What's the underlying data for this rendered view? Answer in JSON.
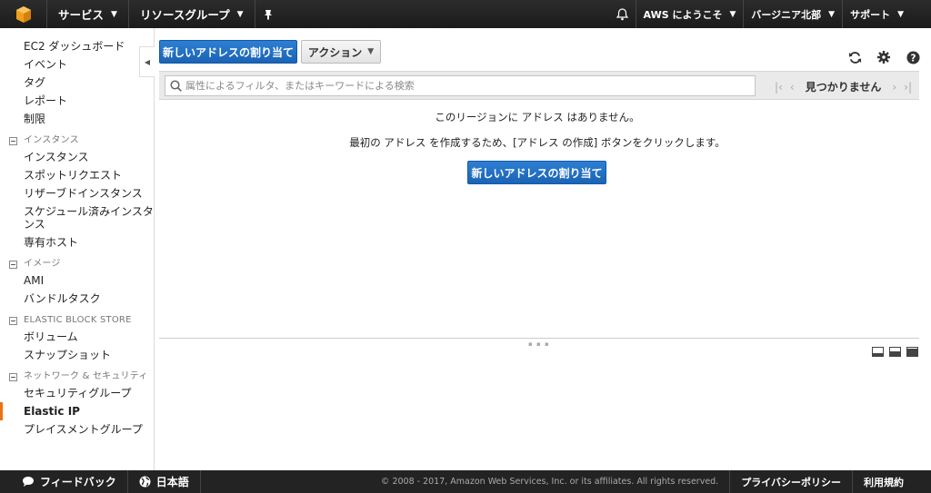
{
  "topnav": {
    "services": "サービス",
    "resource_groups": "リソースグループ",
    "account": "AWS にようこそ",
    "region": "バージニア北部",
    "support": "サポート"
  },
  "sidebar": {
    "top_items": [
      "EC2 ダッシュボード",
      "イベント",
      "タグ",
      "レポート",
      "制限"
    ],
    "sections": [
      {
        "heading": "インスタンス",
        "items": [
          "インスタンス",
          "スポットリクエスト",
          "リザーブドインスタンス",
          "スケジュール済みインスタンス",
          "専有ホスト"
        ]
      },
      {
        "heading": "イメージ",
        "items": [
          "AMI",
          "バンドルタスク"
        ]
      },
      {
        "heading": "ELASTIC BLOCK STORE",
        "items": [
          "ボリューム",
          "スナップショット"
        ]
      },
      {
        "heading": "ネットワーク & セキュリティ",
        "items": [
          "セキュリティグループ",
          "Elastic IP",
          "プレイスメントグループ"
        ]
      }
    ],
    "active_item": "Elastic IP"
  },
  "toolbar": {
    "allocate_label": "新しいアドレスの割り当て",
    "actions_label": "アクション"
  },
  "filter": {
    "placeholder": "属性によるフィルタ、またはキーワードによる検索",
    "pager_label": "見つかりません"
  },
  "empty_state": {
    "line1": "このリージョンに アドレス はありません。",
    "line2": "最初の アドレス を作成するため、[アドレス の作成] ボタンをクリックします。",
    "button_label": "新しいアドレスの割り当て"
  },
  "footer": {
    "feedback": "フィードバック",
    "language": "日本語",
    "copyright": "© 2008 - 2017, Amazon Web Services, Inc. or its affiliates. All rights reserved.",
    "privacy": "プライバシーポリシー",
    "terms": "利用規約"
  },
  "colors": {
    "primary_button": "#1b63b5",
    "active_marker": "#ec7211",
    "topnav_bg": "#232323"
  },
  "icons": {
    "logo": "aws-cube-icon",
    "pin": "pin-icon",
    "bell": "bell-icon",
    "refresh": "refresh-icon",
    "settings": "gear-icon",
    "help": "help-icon",
    "search": "search-icon",
    "feedback": "speech-bubble-icon",
    "language": "globe-icon"
  }
}
